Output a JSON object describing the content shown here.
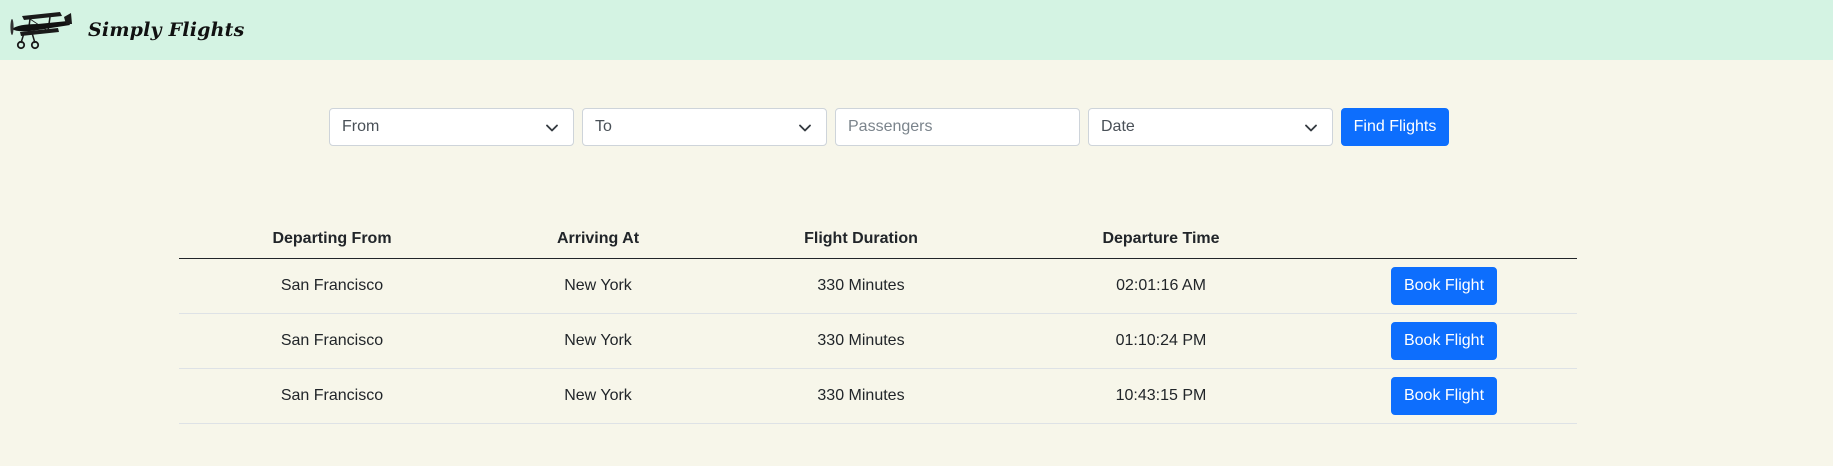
{
  "brand": {
    "name": "Simply Flights",
    "logo_icon": "biplane-icon"
  },
  "search": {
    "from": {
      "selected": "From"
    },
    "to": {
      "selected": "To"
    },
    "passengers": {
      "placeholder": "Passengers",
      "value": ""
    },
    "date": {
      "selected": "Date"
    },
    "submit_label": "Find Flights"
  },
  "table": {
    "headers": [
      "Departing From",
      "Arriving At",
      "Flight Duration",
      "Departure Time",
      ""
    ],
    "rows": [
      {
        "from": "San Francisco",
        "to": "New York",
        "duration": "330 Minutes",
        "departure": "02:01:16 AM",
        "action": "Book Flight"
      },
      {
        "from": "San Francisco",
        "to": "New York",
        "duration": "330 Minutes",
        "departure": "01:10:24 PM",
        "action": "Book Flight"
      },
      {
        "from": "San Francisco",
        "to": "New York",
        "duration": "330 Minutes",
        "departure": "10:43:15 PM",
        "action": "Book Flight"
      }
    ]
  },
  "colors": {
    "navbar_bg": "#d4f3e3",
    "page_bg": "#f7f6ea",
    "primary": "#0d6efd"
  }
}
